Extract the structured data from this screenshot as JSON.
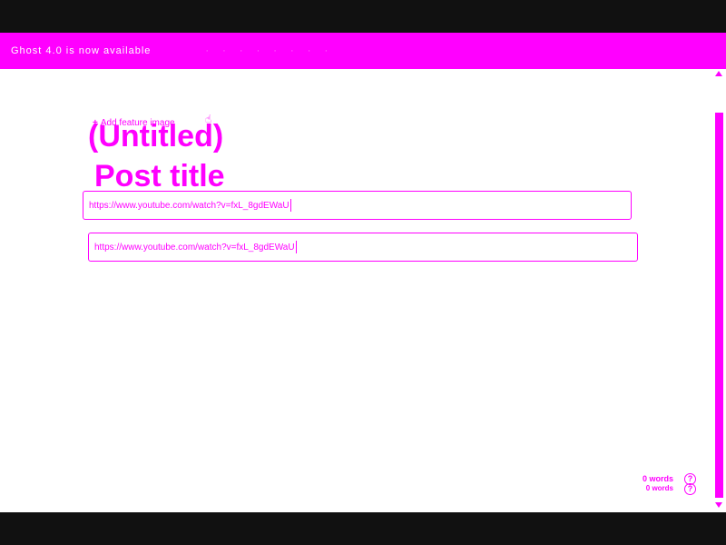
{
  "banner": {
    "text": "Ghost 4.0 is now available",
    "faint_text": "· · · · · · · ·"
  },
  "editor": {
    "feature_image_label": "Add feature image",
    "title_value": "(Untitled)",
    "title_placeholder": "Post title",
    "embeds": [
      {
        "url": "https://www.youtube.com/watch?v=fxL_8gdEWaU"
      },
      {
        "url": "https://www.youtube.com/watch?v=fxL_8gdEWaU"
      }
    ],
    "word_count_primary": "0 words",
    "word_count_secondary": "0 words"
  },
  "icons": {
    "plus": "plus-icon",
    "cursor": "pointer-cursor-icon",
    "help": "help-icon"
  },
  "colors": {
    "accent": "#ff00ff",
    "background": "#ffffff",
    "chrome": "#111111"
  }
}
